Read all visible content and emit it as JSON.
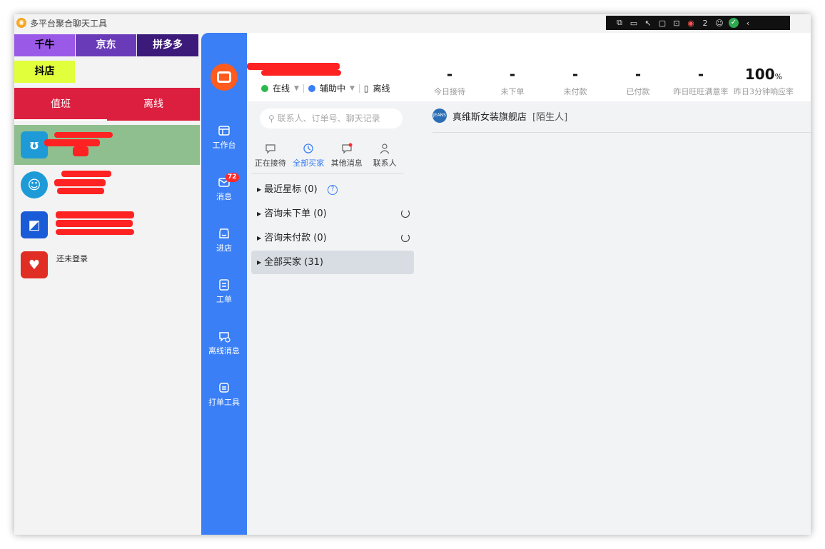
{
  "window": {
    "title": "多平台聚合聊天工具"
  },
  "system_tray": {
    "badge_count": "2"
  },
  "platforms": {
    "qianniu": {
      "label": "千牛",
      "bg": "#9b59e8",
      "color": "#000000"
    },
    "jd": {
      "label": "京东",
      "bg": "#6a3bb8",
      "color": "#ffffff"
    },
    "pdd": {
      "label": "拼多多",
      "bg": "#3b1a7a",
      "color": "#ffffff"
    },
    "douyin": {
      "label": "抖店",
      "bg": "#e2ff3c",
      "color": "#000000"
    }
  },
  "shift_tabs": {
    "on_duty": "值班",
    "offline": "离线"
  },
  "accounts": [
    {
      "icon": "qianniu-icon",
      "color": "#1e9bd7",
      "text": ""
    },
    {
      "icon": "speech-bubble-icon",
      "color": "#1e9bd7",
      "text": ""
    },
    {
      "icon": "jd-dd-icon",
      "color": "#1a5bd7",
      "text": ""
    },
    {
      "icon": "pdd-icon",
      "color": "#e02e24",
      "text": "还未登录"
    }
  ],
  "nav": {
    "workbench": "工作台",
    "messages": "消息",
    "messages_badge": "72",
    "enter_shop": "进店",
    "work_order": "工单",
    "offline_messages": "离线消息",
    "print_tool": "打单工具"
  },
  "status": {
    "online": "在线",
    "assist": "辅助中",
    "offline": "离线"
  },
  "stats": [
    {
      "value": "-",
      "label": "今日接待"
    },
    {
      "value": "-",
      "label": "未下单"
    },
    {
      "value": "-",
      "label": "未付款"
    },
    {
      "value": "-",
      "label": "已付款"
    },
    {
      "value": "-",
      "label": "昨日旺旺满意率"
    },
    {
      "value": "100",
      "unit": "%",
      "label": "昨日3分钟响应率"
    }
  ],
  "search": {
    "placeholder": "联系人、订单号、聊天记录"
  },
  "filter_tabs": {
    "receiving": "正在接待",
    "all_buyers": "全部买家",
    "other": "其他消息",
    "contacts": "联系人"
  },
  "groups": [
    {
      "label": "最近星标 (0)"
    },
    {
      "label": "咨询未下单 (0)"
    },
    {
      "label": "咨询未付款 (0)"
    },
    {
      "label": "全部买家 (31)"
    }
  ],
  "conversation": {
    "shop_name": "真维斯女装旗舰店",
    "tag": "[陌生人]"
  },
  "colors": {
    "nav_blue": "#3a7ff5",
    "red_tab": "#dc1e3f",
    "active_green": "#8fbf8f"
  }
}
